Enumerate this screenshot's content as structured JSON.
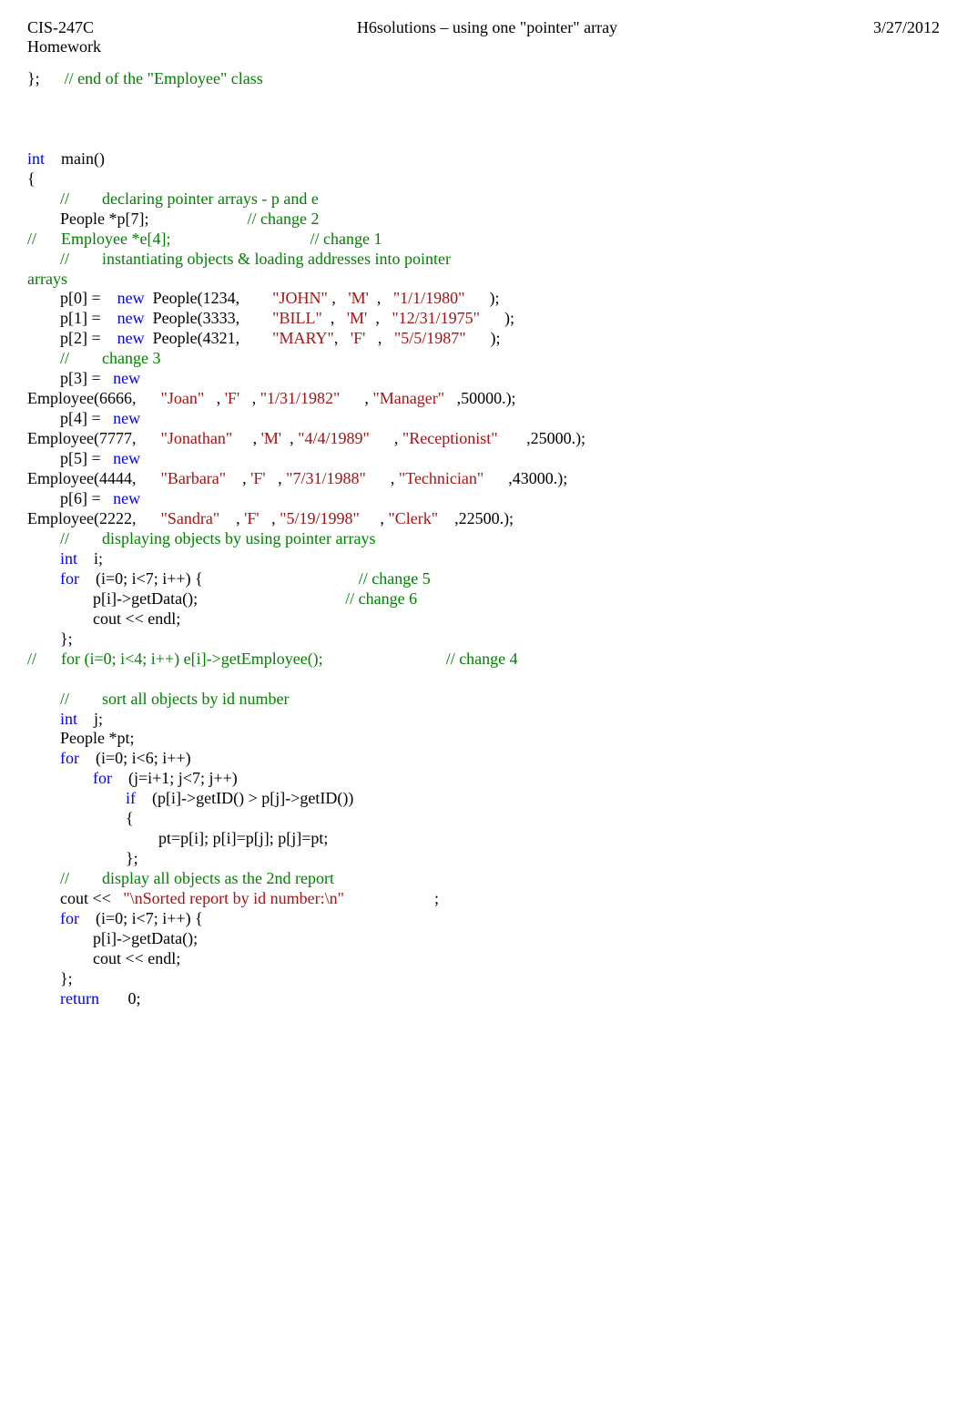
{
  "header": {
    "course": "CIS-247C",
    "label": "Homework",
    "title": "H6solutions – using one \"pointer\" array",
    "date": "3/27/2012"
  },
  "code": {
    "l01a": "};",
    "l01b": "// end of the \"Employee\" class",
    "l02a": "int",
    "l02b": "    main()",
    "l03": "{",
    "l04a": "//",
    "l04b": "declaring pointer arrays - p and e",
    "l05a": "        People *p[7];",
    "l05b": "// change 2",
    "l06a": "//",
    "l06b": "Employee *e[4];",
    "l06c": "// change 1",
    "l07a": "//",
    "l07b": "instantiating objects & loading addresses into pointer",
    "l08": "arrays",
    "l09a": "        p[0] =    ",
    "l09b": "new",
    "l09c": "  People(1234,        ",
    "l09d": "\"JOHN\"",
    "l09e": " ,   ",
    "l09f": "'M'",
    "l09g": "  ,   ",
    "l09h": "\"1/1/1980\"",
    "l09i": "      );",
    "l10a": "        p[1] =    ",
    "l10b": "new",
    "l10c": "  People(3333,        ",
    "l10d": "\"BILL\"",
    "l10e": "  ,   ",
    "l10f": "'M'",
    "l10g": "  ,   ",
    "l10h": "\"12/31/1975\"",
    "l10i": "      );",
    "l11a": "        p[2] =    ",
    "l11b": "new",
    "l11c": "  People(4321,        ",
    "l11d": "\"MARY\"",
    "l11e": ",   ",
    "l11f": "'F'",
    "l11g": "   ,   ",
    "l11h": "\"5/5/1987\"",
    "l11i": "      );",
    "l12a": "//",
    "l12b": "change 3",
    "l13a": "        p[3] =   ",
    "l13b": "new",
    "l14a": "Employee(6666,      ",
    "l14b": "\"Joan\"",
    "l14c": "   , ",
    "l14d": "'F'",
    "l14e": "   , ",
    "l14f": "\"1/31/1982\"",
    "l14g": "      , ",
    "l14h": "\"Manager\"",
    "l14i": "   ,50000.);",
    "l15a": "        p[4] =   ",
    "l15b": "new",
    "l16a": "Employee(7777,      ",
    "l16b": "\"Jonathan\"",
    "l16c": "     , ",
    "l16d": "'M'",
    "l16e": "  , ",
    "l16f": "\"4/4/1989\"",
    "l16g": "      , ",
    "l16h": "\"Receptionist\"",
    "l16i": "       ,25000.);",
    "l17a": "        p[5] =   ",
    "l17b": "new",
    "l18a": "Employee(4444,      ",
    "l18b": "\"Barbara\"",
    "l18c": "    , ",
    "l18d": "'F'",
    "l18e": "   , ",
    "l18f": "\"7/31/1988\"",
    "l18g": "      , ",
    "l18h": "\"Technician\"",
    "l18i": "      ,43000.);",
    "l19a": "        p[6] =   ",
    "l19b": "new",
    "l20a": "Employee(2222,      ",
    "l20b": "\"Sandra\"",
    "l20c": "    , ",
    "l20d": "'F'",
    "l20e": "   , ",
    "l20f": "\"5/19/1998\"",
    "l20g": "     , ",
    "l20h": "\"Clerk\"",
    "l20i": "    ,22500.);",
    "l21a": "//",
    "l21b": "displaying objects by using pointer arrays",
    "l22a": "int",
    "l22b": "    i;",
    "l23a": "for",
    "l23b": "    (i=0; i<7; i++) {",
    "l23c": "// change 5",
    "l24a": "                p[i]->getData();",
    "l24b": "// change 6",
    "l25": "                cout << endl;",
    "l26": "        };",
    "l27a": "//",
    "l27b": "for (i=0; i<4; i++) e[i]->getEmployee();",
    "l27c": "// change 4",
    "l28a": "//",
    "l28b": "sort all objects by id number",
    "l29a": "int",
    "l29b": "    j;",
    "l30": "        People *pt;",
    "l31a": "for",
    "l31b": "    (i=0; i<6; i++)",
    "l32a": "for",
    "l32b": "    (j=i+1; j<7; j++)",
    "l33a": "if",
    "l33b": "    (p[i]->getID() > p[j]->getID())",
    "l34": "                        {",
    "l35": "                                pt=p[i]; p[i]=p[j]; p[j]=pt;",
    "l36": "                        };",
    "l37a": "//",
    "l37b": "display all objects as the 2nd report",
    "l38a": "        cout <<   ",
    "l38b": "\"\\nSorted report by id number:\\n\"",
    "l38c": "                      ;",
    "l39a": "for",
    "l39b": "    (i=0; i<7; i++) {",
    "l40": "                p[i]->getData();",
    "l41": "                cout << endl;",
    "l42": "        };",
    "l43a": "return",
    "l43b": "       0;"
  }
}
